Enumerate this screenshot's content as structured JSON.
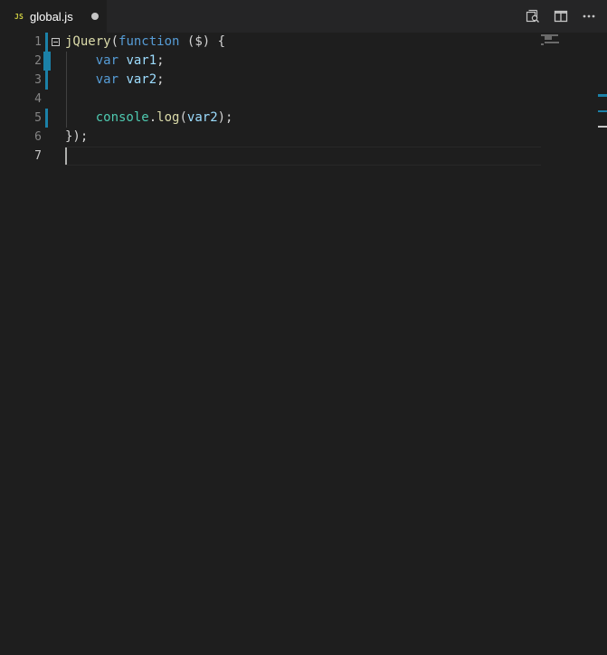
{
  "tab": {
    "language_icon": "JS",
    "filename": "global.js",
    "dirty": true
  },
  "actions": [
    {
      "name": "open-changes-icon"
    },
    {
      "name": "split-editor-icon"
    },
    {
      "name": "more-actions-icon"
    }
  ],
  "editor": {
    "line_numbers": [
      "1",
      "2",
      "3",
      "4",
      "5",
      "6",
      "7"
    ],
    "active_line": 7,
    "lines": [
      [
        {
          "t": "jQuery",
          "c": "fn"
        },
        {
          "t": "(",
          "c": "punc"
        },
        {
          "t": "function",
          "c": "kw"
        },
        {
          "t": " (",
          "c": "punc"
        },
        {
          "t": "$",
          "c": "punc"
        },
        {
          "t": ") {",
          "c": "punc"
        }
      ],
      [
        {
          "t": "    ",
          "c": "punc"
        },
        {
          "t": "var",
          "c": "kw"
        },
        {
          "t": " ",
          "c": "punc"
        },
        {
          "t": "var1",
          "c": "var"
        },
        {
          "t": ";",
          "c": "punc"
        }
      ],
      [
        {
          "t": "    ",
          "c": "punc"
        },
        {
          "t": "var",
          "c": "kw"
        },
        {
          "t": " ",
          "c": "punc"
        },
        {
          "t": "var2",
          "c": "var"
        },
        {
          "t": ";",
          "c": "punc"
        }
      ],
      [],
      [
        {
          "t": "    ",
          "c": "punc"
        },
        {
          "t": "console",
          "c": "obj"
        },
        {
          "t": ".",
          "c": "punc"
        },
        {
          "t": "log",
          "c": "fn"
        },
        {
          "t": "(",
          "c": "punc"
        },
        {
          "t": "var2",
          "c": "var"
        },
        {
          "t": ");",
          "c": "punc"
        }
      ],
      [
        {
          "t": "});",
          "c": "punc"
        }
      ],
      []
    ]
  },
  "colors": {
    "background": "#1e1e1e",
    "tab_bar": "#252526",
    "git_modified": "#1b81a8",
    "function": "#dcdcaa",
    "keyword": "#569cd6",
    "variable": "#9cdcfe",
    "object": "#4ec9b0"
  }
}
